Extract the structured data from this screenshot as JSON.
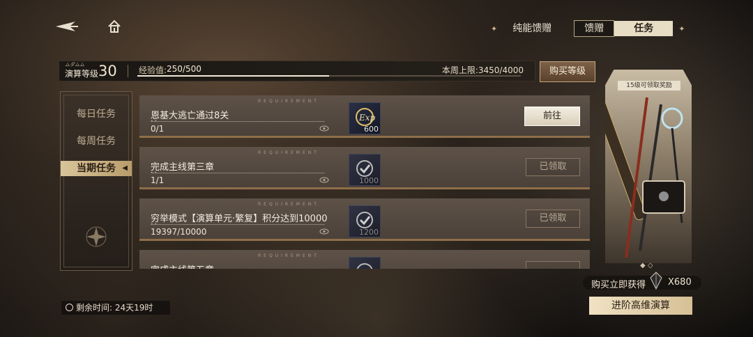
{
  "header": {
    "tabs": [
      {
        "label": "纯能馈赠"
      },
      {
        "label": "馈赠"
      },
      {
        "label": "任务"
      }
    ]
  },
  "level": {
    "small_label": "ムダムム",
    "label": "演算等级",
    "value": "30",
    "exp_label": "经验值:",
    "exp_value": "250/500",
    "exp_progress": 0.5,
    "week_cap": "本周上限:3450/4000",
    "buy_button": "购买等级"
  },
  "sidebar": {
    "items": [
      {
        "label": "每日任务",
        "active": false
      },
      {
        "label": "每周任务",
        "active": false
      },
      {
        "label": "当期任务",
        "active": true
      }
    ]
  },
  "tasks": [
    {
      "req": "REQUIREMENT",
      "name": "恩基大逃亡通过8关",
      "progress": "0/1",
      "reward_amount": "600",
      "reward_icon": "exp-icon",
      "action": "前往",
      "status": "go"
    },
    {
      "req": "REQUIREMENT",
      "name": "完成主线第三章",
      "progress": "1/1",
      "reward_amount": "1000",
      "reward_icon": "check-badge-icon",
      "action": "已领取",
      "status": "done"
    },
    {
      "req": "REQUIREMENT",
      "name": "穷举模式【演算单元·繁复】积分达到10000",
      "progress": "19397/10000",
      "reward_amount": "1200",
      "reward_icon": "check-badge-icon",
      "action": "已领取",
      "status": "done"
    },
    {
      "req": "REQUIREMENT",
      "name": "完成主线第五章",
      "progress": "",
      "reward_amount": "",
      "reward_icon": "check-badge-icon",
      "action": "",
      "status": "done"
    }
  ],
  "timer": {
    "label": "剩余时间: 24天19时"
  },
  "promo": {
    "label": "15级可领取奖励",
    "buy_now": "购买立即获得",
    "buy_now_amount": "X680",
    "advance_button": "进阶高维演算"
  },
  "colors": {
    "accent": "#d9c49a",
    "button_bg": "#6d5440"
  }
}
